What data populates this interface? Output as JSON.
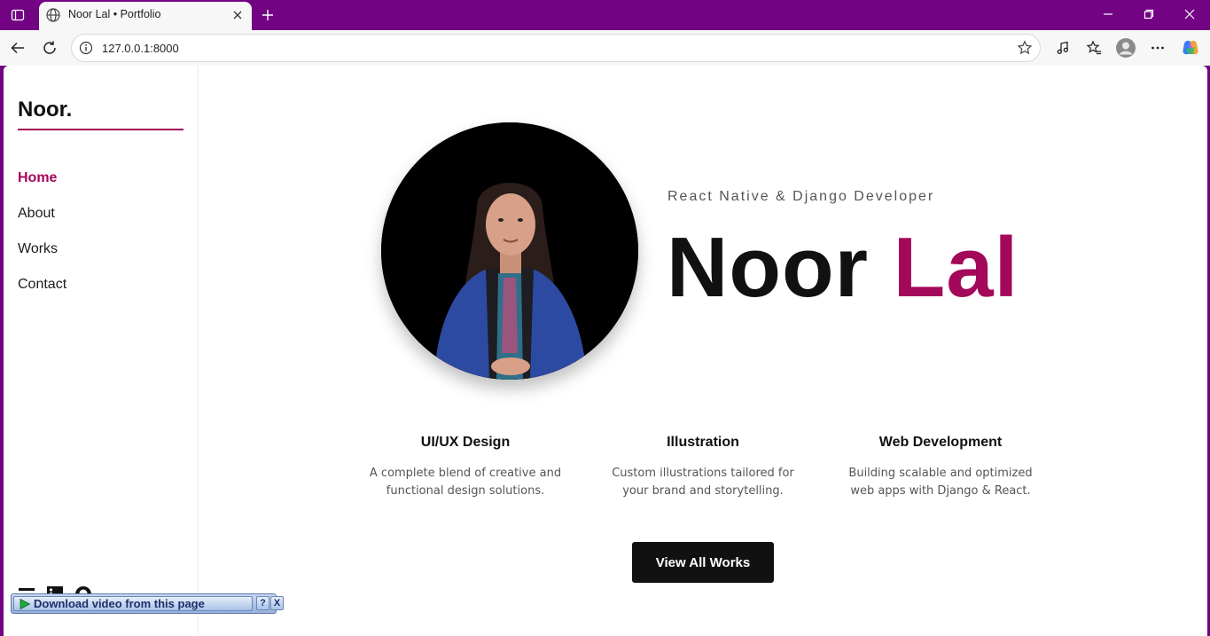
{
  "browser": {
    "tab_title": "Noor Lal • Portfolio",
    "url": "127.0.0.1:8000",
    "theme_color": "#720383"
  },
  "sidebar": {
    "logo": "Noor.",
    "nav": [
      {
        "label": "Home",
        "active": true
      },
      {
        "label": "About",
        "active": false
      },
      {
        "label": "Works",
        "active": false
      },
      {
        "label": "Contact",
        "active": false
      }
    ],
    "socials": [
      "menu-icon",
      "linkedin-icon",
      "github-icon"
    ]
  },
  "download_bar": {
    "label": "Download video from this page",
    "help": "?",
    "close": "X"
  },
  "hero": {
    "subtitle": "React Native & Django Developer",
    "first_name": "Noor",
    "last_name": "Lal",
    "accent_color": "#a3085a"
  },
  "services": [
    {
      "title": "UI/UX Design",
      "line1": "A complete blend of creative and",
      "line2": "functional design solutions."
    },
    {
      "title": "Illustration",
      "line1": "Custom illustrations tailored for",
      "line2": "your brand and storytelling."
    },
    {
      "title": "Web Development",
      "line1": "Building scalable and optimized",
      "line2": "web apps with Django & React."
    }
  ],
  "cta": {
    "label": "View All Works"
  }
}
